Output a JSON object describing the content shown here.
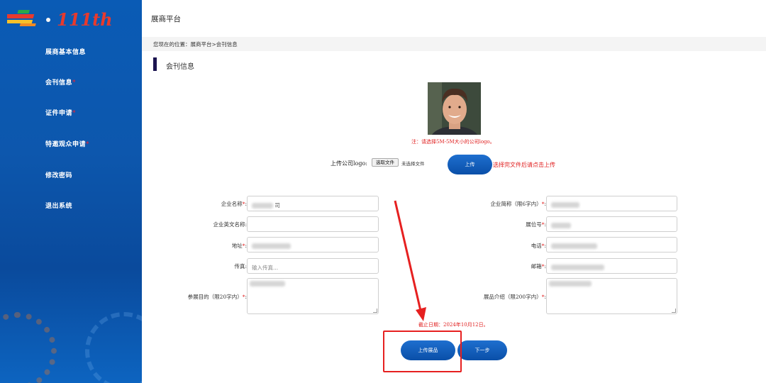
{
  "logo": {
    "suffix_text": "111th"
  },
  "sidebar": {
    "items": [
      {
        "label": "展商基本信息",
        "required": ""
      },
      {
        "label": "会刊信息",
        "required": "*"
      },
      {
        "label": "证件申请",
        "required": "*"
      },
      {
        "label": "特邀观众申请",
        "required": "*"
      },
      {
        "label": "修改密码",
        "required": ""
      },
      {
        "label": "退出系统",
        "required": ""
      }
    ]
  },
  "header": {
    "title": "展商平台"
  },
  "breadcrumb": "您现在的位置：展商平台>会刊信息",
  "section": {
    "title": "会刊信息"
  },
  "logo_upload": {
    "note": "注：请选择5M-5M大小的公司logo。",
    "label": "上传公司logo:",
    "choose_file": "选取文件",
    "no_file": "未选择文件",
    "upload_button": "上传",
    "hint": "选择完文件后请点击上传"
  },
  "form": {
    "left": [
      {
        "label": "企业名称",
        "star": "*",
        "value": "司",
        "placeholder": ""
      },
      {
        "label": "企业英文名称",
        "star": "",
        "value": "",
        "placeholder": ""
      },
      {
        "label": "地址",
        "star": "*",
        "value": "",
        "placeholder": ""
      },
      {
        "label": "传真",
        "star": "",
        "value": "",
        "placeholder": "输入传真..."
      }
    ],
    "right": [
      {
        "label": "企业简称（限6字内）",
        "star": "*",
        "value": "",
        "placeholder": ""
      },
      {
        "label": "展位号",
        "star": "*",
        "value": "",
        "placeholder": ""
      },
      {
        "label": "电话",
        "star": "*",
        "value": "",
        "placeholder": ""
      },
      {
        "label": "邮箱",
        "star": "*",
        "value": "",
        "placeholder": ""
      }
    ],
    "purpose_label": "参展目的（限20字内）",
    "purpose_star": "*",
    "purpose_value": "",
    "intro_label": "展品介绍（限200字内）",
    "intro_star": "*",
    "intro_value": ""
  },
  "deadline": "截止日期：2024年10月12日。",
  "buttons": {
    "upload_products": "上传展品",
    "next": "下一步"
  },
  "colors": {
    "sidebar": "#0a5bb5",
    "accent": "#0a4fa8",
    "warning": "#e02020"
  }
}
